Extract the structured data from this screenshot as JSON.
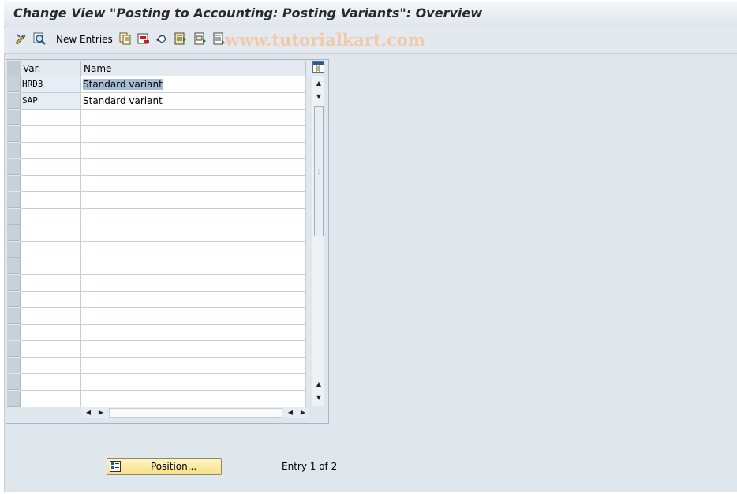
{
  "window": {
    "title": "Change View \"Posting to Accounting: Posting Variants\": Overview"
  },
  "toolbar": {
    "new_entries_label": "New Entries",
    "icons": [
      "display-change-icon",
      "details-icon",
      "copy-icon",
      "delete-icon",
      "undo-icon",
      "select-all-icon",
      "select-block-icon",
      "deselect-all-icon"
    ]
  },
  "watermark": "www.tutorialkart.com",
  "table": {
    "columns": [
      "Var.",
      "Name"
    ],
    "rows": [
      {
        "var": "HRD3",
        "name": "Standard variant"
      },
      {
        "var": "SAP",
        "name": "Standard variant"
      }
    ]
  },
  "footer": {
    "position_button_label": "Position...",
    "entry_text": "Entry 1 of 2"
  },
  "colors": {
    "title_bar": "#dfe6ec",
    "button_yellow": "#f7df85",
    "selection": "#a6bcd3"
  }
}
